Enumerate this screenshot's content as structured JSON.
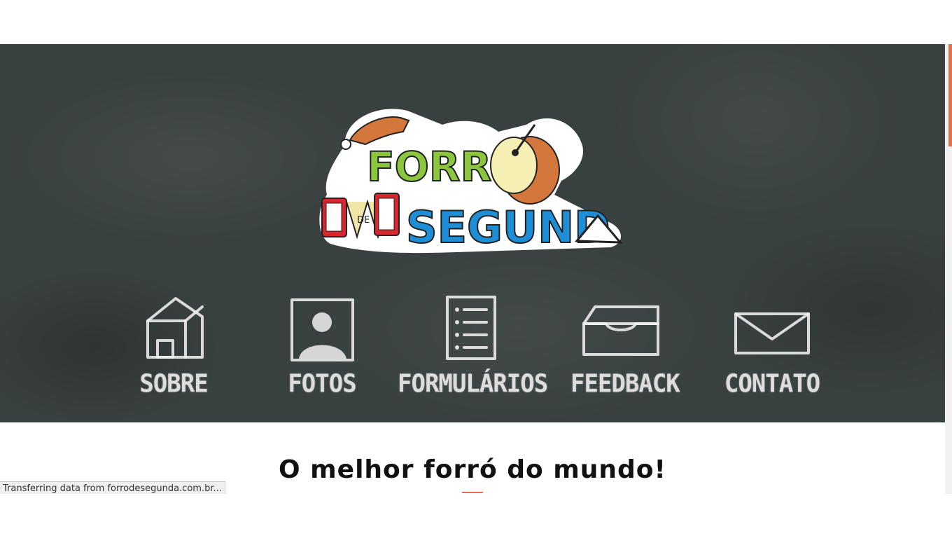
{
  "logo": {
    "word1": "FORR",
    "connector": "DE",
    "word2": "SEGUND"
  },
  "nav": {
    "items": [
      {
        "label": "SOBRE",
        "icon": "house-icon"
      },
      {
        "label": "FOTOS",
        "icon": "photo-portrait-icon"
      },
      {
        "label": "FORMULÁRIOS",
        "icon": "form-list-icon"
      },
      {
        "label": "FEEDBACK",
        "icon": "inbox-tray-icon"
      },
      {
        "label": "CONTATO",
        "icon": "envelope-icon"
      }
    ]
  },
  "main": {
    "headline": "O melhor forró do mundo!"
  },
  "status": {
    "text": "Transferring data from forrodesegunda.com.br..."
  },
  "colors": {
    "chalkboard": "#394040",
    "accent": "#e0714a",
    "logo_green": "#8cc63f",
    "logo_blue": "#1e8fd6",
    "logo_red": "#d7262e"
  }
}
